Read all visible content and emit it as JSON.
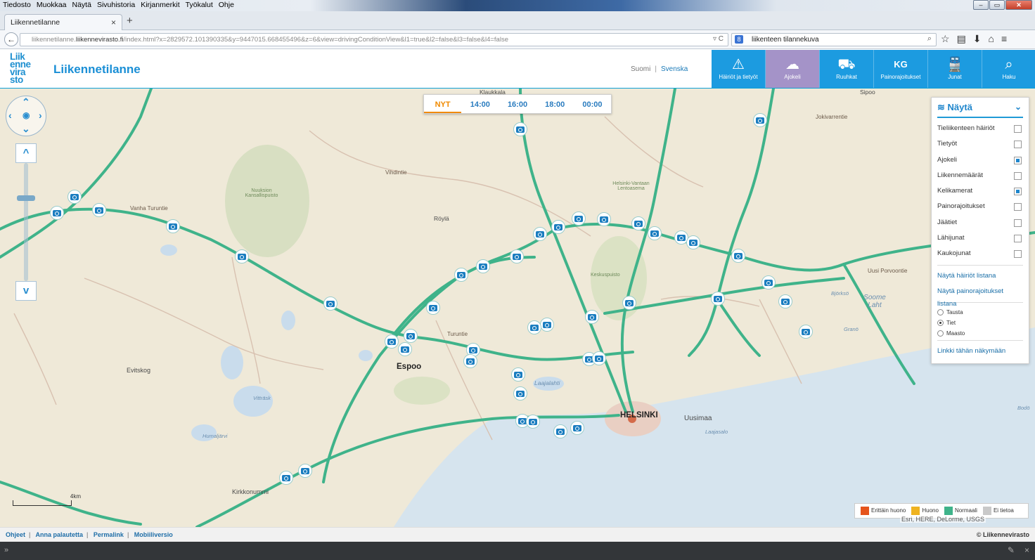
{
  "browser": {
    "menus": [
      "Tiedosto",
      "Muokkaa",
      "Näytä",
      "Sivuhistoria",
      "Kirjanmerkit",
      "Työkalut",
      "Ohje"
    ],
    "tab_title": "Liikennetilanne",
    "url_prefix": "liikennetilanne.",
    "url_host": "liikennevirasto.fi",
    "url_rest": "/index.html?x=2829572.101390335&y=9447015.668455496&z=6&view=drivingConditionView&l1=true&l2=false&l3=false&l4=false",
    "search_value": "liikenteen tilannekuva"
  },
  "header": {
    "logo_lines": [
      "Liik",
      "enne",
      "vira",
      "sto"
    ],
    "title": "Liikennetilanne",
    "lang_fi": "Suomi",
    "lang_sep": "|",
    "lang_sv": "Svenska"
  },
  "topnav": [
    {
      "label": "Häiriöt ja tietyöt",
      "icon": "warning-icon",
      "glyph": "⚠",
      "active": false
    },
    {
      "label": "Ajokeli",
      "icon": "weather-icon",
      "glyph": "☁",
      "active": true
    },
    {
      "label": "Ruuhkat",
      "icon": "cars-icon",
      "glyph": "⛟",
      "active": false
    },
    {
      "label": "Painorajoitukset",
      "icon": "weight-icon",
      "glyph": "KG",
      "active": false
    },
    {
      "label": "Junat",
      "icon": "train-icon",
      "glyph": "🚆",
      "active": false
    },
    {
      "label": "Haku",
      "icon": "search-icon",
      "glyph": "⌕",
      "active": false
    }
  ],
  "timebar": [
    "NYT",
    "14:00",
    "16:00",
    "18:00",
    "00:00"
  ],
  "layers": {
    "title": "Näytä",
    "items": [
      {
        "label": "Tieliikenteen häiriöt",
        "checked": false
      },
      {
        "label": "Tietyöt",
        "checked": false
      },
      {
        "label": "Ajokeli",
        "checked": true
      },
      {
        "label": "Liikennemäärät",
        "checked": false
      },
      {
        "label": "Kelikamerat",
        "checked": true
      },
      {
        "label": "Painorajoitukset",
        "checked": false
      },
      {
        "label": "Jäätiet",
        "checked": false
      },
      {
        "label": "Lähijunat",
        "checked": false
      },
      {
        "label": "Kaukojunat",
        "checked": false
      }
    ],
    "link_list": "Näytä häiriöt listana",
    "link_weight": "Näytä painorajoitukset listana",
    "bg_options": [
      {
        "label": "Tausta",
        "selected": false
      },
      {
        "label": "Tiet",
        "selected": true
      },
      {
        "label": "Maasto",
        "selected": false
      }
    ],
    "link_view": "Linkki tähän näkymään"
  },
  "legend": [
    {
      "label": "Erittäin huono",
      "color": "#e5541c"
    },
    {
      "label": "Huono",
      "color": "#efb321"
    },
    {
      "label": "Normaali",
      "color": "#3fb38a"
    },
    {
      "label": "Ei tietoa",
      "color": "#c9c9c9"
    }
  ],
  "map_labels": {
    "espoo": "Espoo",
    "helsinki": "HELSINKI",
    "kirkkonummi": "Kirkkonummi",
    "evitskog": "Evitskog",
    "royla": "Röylä",
    "klaukkala": "Klaukkala",
    "uusimaa": "Uusimaa",
    "soome_laht": "Soome Laht",
    "nuuksio": "Nuuksion Kansallispuisto",
    "airport": "Helsinki-Vantaan Lentoasema",
    "keskuspuisto": "Keskuspuisto",
    "laajalahti": "Laajalahti",
    "vittrask": "Vitträsk",
    "humaljarvi": "Humaljärvi",
    "bjorkso": "Björksö",
    "grano": "Granö",
    "bodo": "Bodö",
    "laajasalo": "Laajasalo",
    "sipoo": "Sipoo",
    "vanha_turuntie": "Vanha Turuntie",
    "vihdintie": "Vihdintie",
    "turuntie": "Turuntie",
    "uusi_porvoontie": "Uusi Porvoontie",
    "jokivarrentie": "Jokivarrentie",
    "scale": "4km"
  },
  "map_attribution": "Esri, HERE, DeLorme, USGS",
  "footer": {
    "links": [
      "Ohjeet",
      "Anna palautetta",
      "Permalink",
      "Mobiiliversio"
    ],
    "copyright": "© Liikennevirasto"
  }
}
